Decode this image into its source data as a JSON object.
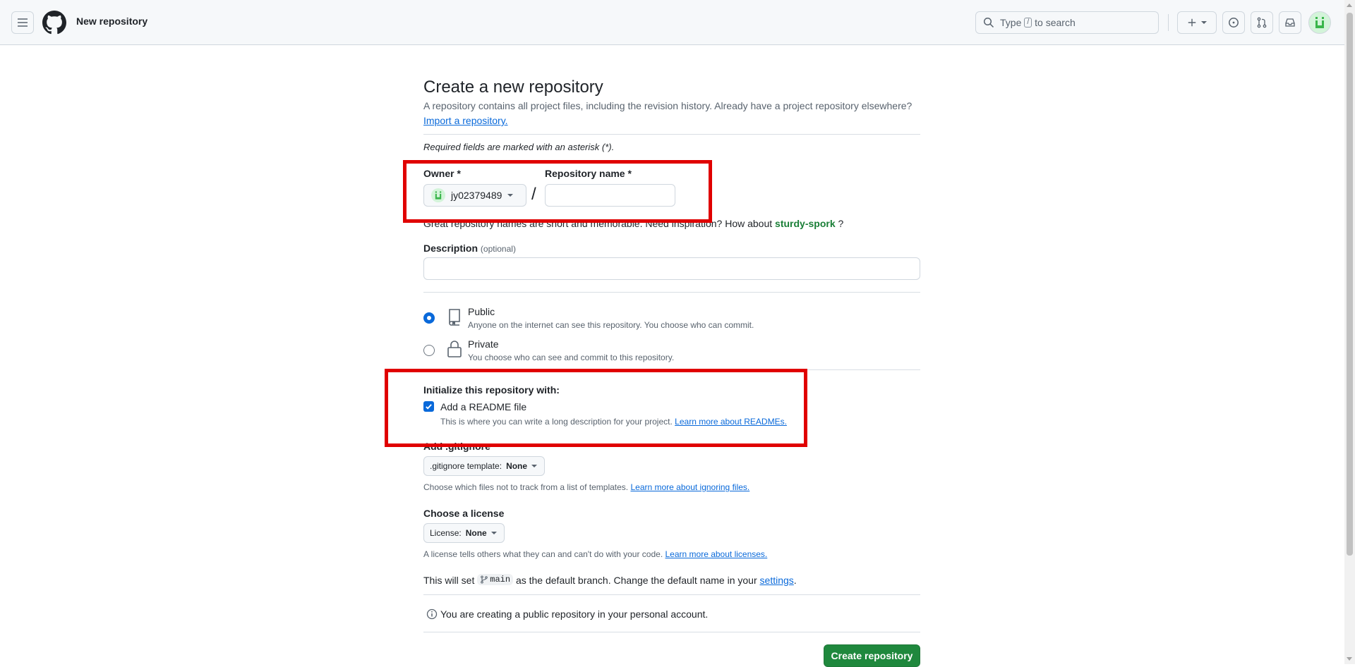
{
  "header": {
    "context_title": "New repository",
    "search_text_before": "Type",
    "search_key": "/",
    "search_text_after": "to search"
  },
  "page": {
    "title": "Create a new repository",
    "subtitle": "A repository contains all project files, including the revision history. Already have a project repository elsewhere?",
    "import_link": "Import a repository.",
    "required_note": "Required fields are marked with an asterisk (*)."
  },
  "form": {
    "owner_label": "Owner *",
    "owner_value": "jy02379489",
    "repo_name_label": "Repository name *",
    "repo_name_value": "",
    "hint_prefix": "Great repository names are short and memorable. Need inspiration? How about",
    "hint_suggestion": "sturdy-spork",
    "hint_suffix": "?",
    "description_label": "Description",
    "description_optional": "(optional)",
    "description_value": "",
    "visibility": {
      "public_title": "Public",
      "public_desc": "Anyone on the internet can see this repository. You choose who can commit.",
      "private_title": "Private",
      "private_desc": "You choose who can see and commit to this repository.",
      "selected": "public"
    },
    "init_heading": "Initialize this repository with:",
    "readme_label": "Add a README file",
    "readme_checked": true,
    "readme_desc": "This is where you can write a long description for your project.",
    "readme_link": "Learn more about READMEs.",
    "gitignore_label": "Add .gitignore",
    "gitignore_prefix": ".gitignore template:",
    "gitignore_value": "None",
    "gitignore_desc": "Choose which files not to track from a list of templates.",
    "gitignore_link": "Learn more about ignoring files.",
    "license_label": "Choose a license",
    "license_prefix": "License:",
    "license_value": "None",
    "license_desc": "A license tells others what they can and can't do with your code.",
    "license_link": "Learn more about licenses.",
    "branch_prefix": "This will set",
    "branch_name": "main",
    "branch_middle": "as the default branch. Change the default name in your",
    "branch_link": "settings",
    "branch_end": ".",
    "info_note": "You are creating a public repository in your personal account.",
    "submit_label": "Create repository"
  },
  "colors": {
    "primary_button": "#1f883d",
    "link": "#0969da",
    "suggestion": "#1a7f37",
    "annotation_box": "#e00000"
  },
  "icons": [
    "hamburger-icon",
    "github-logo-icon",
    "search-icon",
    "plus-icon",
    "issues-icon",
    "pull-request-icon",
    "inbox-icon",
    "avatar-icon",
    "repo-icon",
    "lock-icon",
    "check-icon",
    "branch-icon",
    "info-icon"
  ]
}
